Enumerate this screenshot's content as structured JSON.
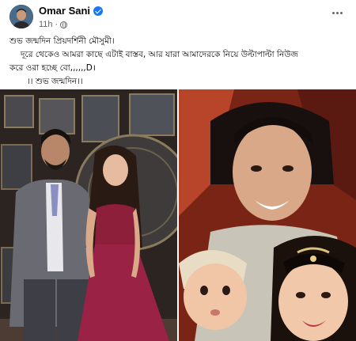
{
  "post": {
    "author": "Omar Sani",
    "time": "11h",
    "dot": "·",
    "text_lines": [
      "শুভ জন্মদিন প্রিয়দর্শিনী মৌসুমী।",
      "দূরে থেকেও আমরা কাছে এটাই বাস্তব, আর যারা আমাদেরকে নিয়ে উল্টাপাল্টা নিউজ",
      "করে ওরা হচ্ছে বো,,,,,,D।",
      "।। শুভ জন্মদিন।।"
    ]
  },
  "icons": {
    "avatar": "profile-avatar",
    "verified": "verified-badge-icon",
    "audience": "globe-icon",
    "more": "more-options-icon"
  },
  "colors": {
    "verified": "#1877f2",
    "meta": "#65676b",
    "text": "#050505"
  }
}
